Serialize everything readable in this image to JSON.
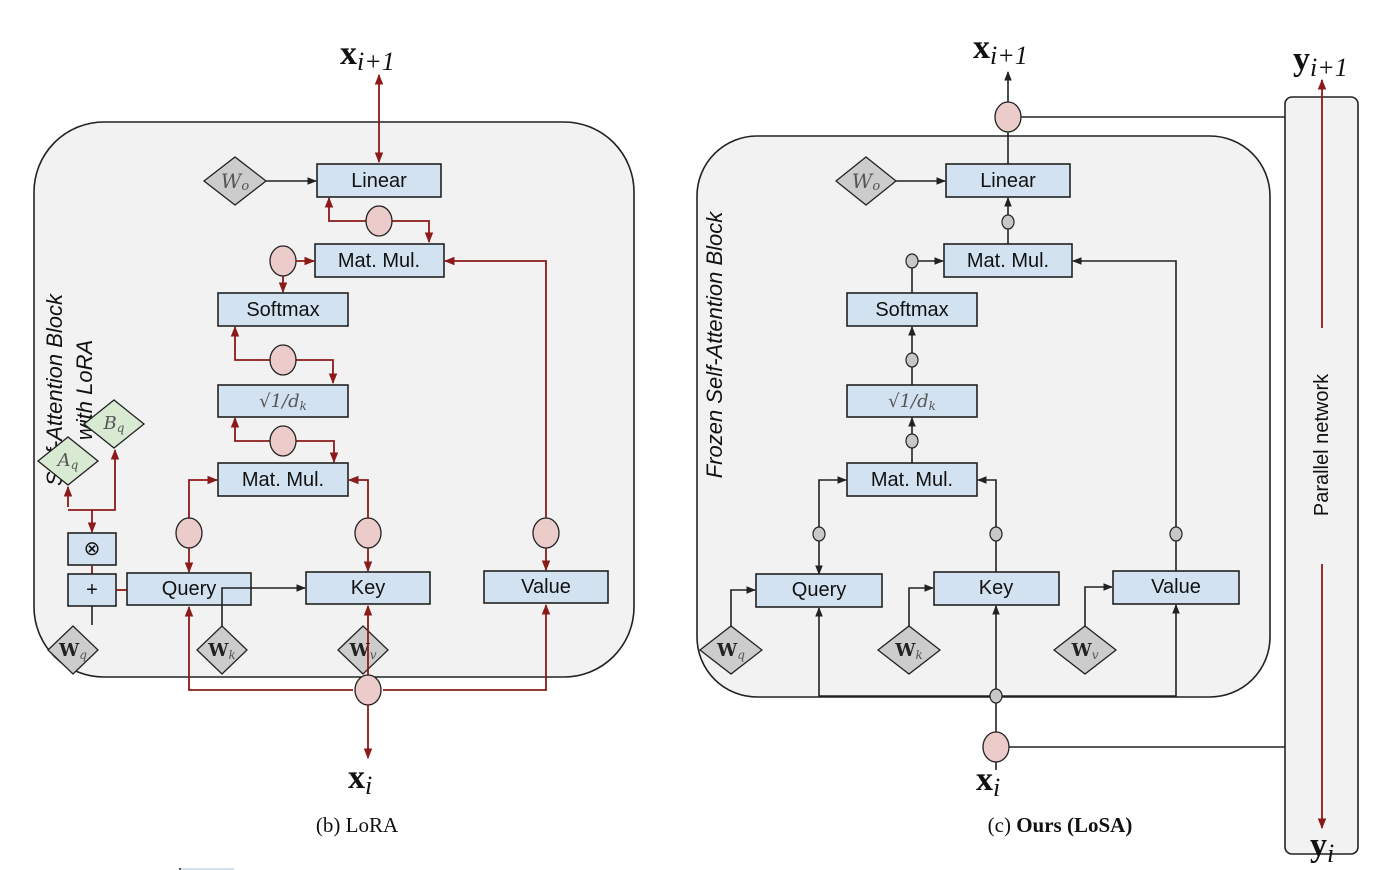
{
  "colors": {
    "box_fill": "#d3e2f1",
    "panel_fill": "#f2f2f2",
    "weight_fill": "#cccccc",
    "lora_fill": "#d9ead3",
    "node_red": "#eccbcb",
    "arrow_red": "#8b1a1a",
    "arrow_black": "#222222"
  },
  "lora": {
    "caption": "(b) LoRA",
    "panel_title_line1": "Self-Attention Block",
    "panel_title_line2": "with LoRA",
    "output_label": "x",
    "output_sub": "i+1",
    "input_label": "x",
    "input_sub": "i",
    "boxes": {
      "linear": "Linear",
      "matmul_top": "Mat. Mul.",
      "softmax": "Softmax",
      "scale": "√1/d",
      "scale_sub": "k",
      "matmul_bottom": "Mat. Mul.",
      "query": "Query",
      "key": "Key",
      "value": "Value",
      "otimes": "⊗",
      "plus": "+"
    },
    "weights": {
      "wo": "W",
      "wo_sub": "o",
      "wq": "W",
      "wq_sub": "q",
      "wk": "W",
      "wk_sub": "k",
      "wv": "W",
      "wv_sub": "v",
      "aq": "A",
      "aq_sub": "q",
      "bq": "B",
      "bq_sub": "q"
    }
  },
  "losa": {
    "caption_prefix": "(c) ",
    "caption_bold": "Ours (LoSA)",
    "panel_title": "Frozen Self-Attention Block",
    "parallel_label": "Parallel network",
    "output_label": "x",
    "output_sub": "i+1",
    "input_label": "x",
    "input_sub": "i",
    "y_out_label": "y",
    "y_out_sub": "i+1",
    "y_in_label": "y",
    "y_in_sub": "i",
    "boxes": {
      "linear": "Linear",
      "matmul_top": "Mat. Mul.",
      "softmax": "Softmax",
      "scale": "√1/d",
      "scale_sub": "k",
      "matmul_bottom": "Mat. Mul.",
      "query": "Query",
      "key": "Key",
      "value": "Value"
    },
    "weights": {
      "wo": "W",
      "wo_sub": "o",
      "wq": "W",
      "wq_sub": "q",
      "wk": "W",
      "wk_sub": "k",
      "wv": "W",
      "wv_sub": "v"
    }
  }
}
